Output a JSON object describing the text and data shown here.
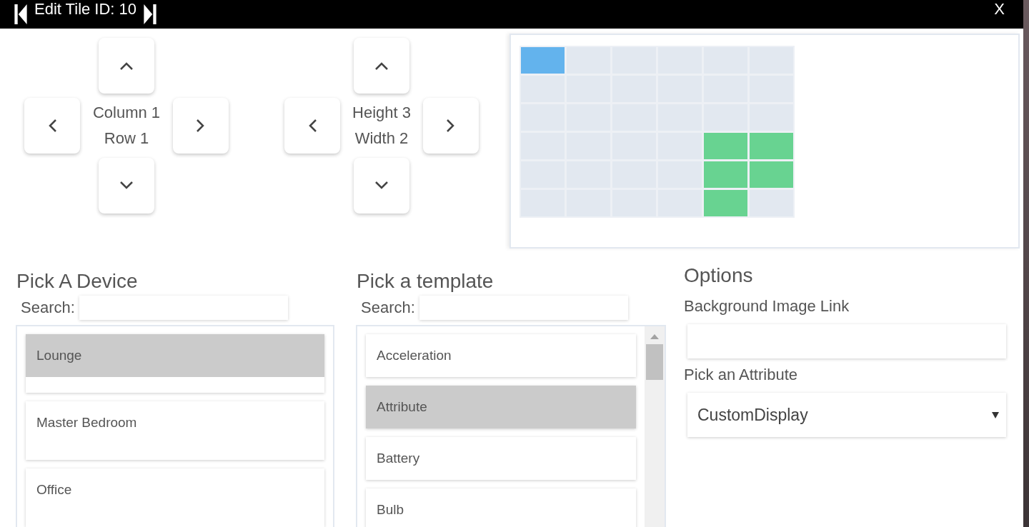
{
  "header": {
    "title": "Edit Tile ID: 10",
    "close": "X"
  },
  "position": {
    "lines": [
      "Column 1",
      "Row 1"
    ]
  },
  "size": {
    "lines": [
      "Height 3",
      "Width 2"
    ]
  },
  "grid": {
    "rows": [
      [
        {
          "kind": "current"
        },
        {
          "kind": "free"
        },
        {
          "kind": "free"
        },
        {
          "kind": "free"
        },
        {
          "kind": "free"
        },
        {
          "kind": "free"
        }
      ],
      [
        {
          "kind": "free"
        },
        {
          "kind": "free"
        },
        {
          "kind": "free"
        },
        {
          "kind": "free"
        },
        {
          "kind": "free"
        },
        {
          "kind": "free"
        }
      ],
      [
        {
          "kind": "free"
        },
        {
          "kind": "free"
        },
        {
          "kind": "free"
        },
        {
          "kind": "free"
        },
        {
          "kind": "free"
        },
        {
          "kind": "free"
        }
      ],
      [
        {
          "kind": "free"
        },
        {
          "kind": "free"
        },
        {
          "kind": "free"
        },
        {
          "kind": "free"
        },
        {
          "kind": "taken"
        },
        {
          "kind": "taken"
        }
      ],
      [
        {
          "kind": "free"
        },
        {
          "kind": "free"
        },
        {
          "kind": "free"
        },
        {
          "kind": "free"
        },
        {
          "kind": "taken"
        },
        {
          "kind": "taken"
        }
      ],
      [
        {
          "kind": "free"
        },
        {
          "kind": "free"
        },
        {
          "kind": "free"
        },
        {
          "kind": "free"
        },
        {
          "kind": "taken"
        },
        {
          "kind": "free"
        }
      ]
    ]
  },
  "devices": {
    "title": "Pick A Device",
    "search_label": "Search:",
    "items": [
      {
        "label": "Lounge",
        "selected": true
      },
      {
        "label": "Master Bedroom",
        "selected": false
      },
      {
        "label": "Office",
        "selected": false
      }
    ]
  },
  "templates": {
    "title": "Pick a template",
    "search_label": "Search:",
    "items": [
      {
        "label": "Acceleration",
        "selected": false
      },
      {
        "label": "Attribute",
        "selected": true
      },
      {
        "label": "Battery",
        "selected": false
      },
      {
        "label": "Bulb",
        "selected": false
      }
    ]
  },
  "options": {
    "title": "Options",
    "background_label": "Background Image Link",
    "attribute_label": "Pick an Attribute",
    "attribute_value": "CustomDisplay"
  }
}
